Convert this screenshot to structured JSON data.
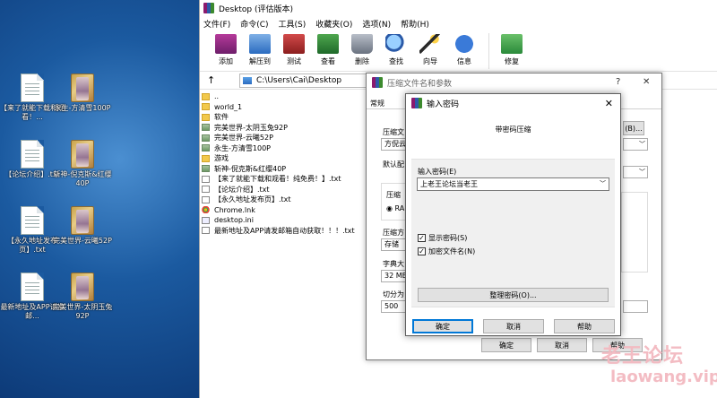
{
  "desktop": {
    "icons": [
      {
        "label": "【来了就能下载和观看！...",
        "type": "doc"
      },
      {
        "label": "永生-方清雪100P",
        "type": "folder"
      },
      {
        "label": "【论坛介绍】.txt",
        "type": "doc"
      },
      {
        "label": "斩神-倪克斯&红缨40P",
        "type": "folder"
      },
      {
        "label": "【永久地址发布页】.txt",
        "type": "doc"
      },
      {
        "label": "完美世界-云曦52P",
        "type": "folder"
      },
      {
        "label": "最新地址及APP请发邮...",
        "type": "doc"
      },
      {
        "label": "完美世界-太阴玉兔92P",
        "type": "folder"
      }
    ]
  },
  "window": {
    "title": "Desktop (评估版本)",
    "menu": [
      "文件(F)",
      "命令(C)",
      "工具(S)",
      "收藏夹(O)",
      "选项(N)",
      "帮助(H)"
    ],
    "toolbar": [
      {
        "label": "添加",
        "icon": "add-icon"
      },
      {
        "label": "解压到",
        "icon": "extract-icon"
      },
      {
        "label": "测试",
        "icon": "test-icon"
      },
      {
        "label": "查看",
        "icon": "view-icon"
      },
      {
        "label": "删除",
        "icon": "delete-icon"
      },
      {
        "label": "查找",
        "icon": "find-icon"
      },
      {
        "label": "向导",
        "icon": "wizard-icon"
      },
      {
        "label": "信息",
        "icon": "info-icon"
      },
      {
        "label": "修复",
        "icon": "repair-icon"
      }
    ],
    "address": "C:\\Users\\Cai\\Desktop",
    "files": [
      {
        "name": "..",
        "type": "folder"
      },
      {
        "name": "world_1",
        "type": "folder"
      },
      {
        "name": "软件",
        "type": "folder"
      },
      {
        "name": "完美世界-太阴玉兔92P",
        "type": "zip"
      },
      {
        "name": "完美世界-云曦52P",
        "type": "zip"
      },
      {
        "name": "永生-方清雪100P",
        "type": "zip"
      },
      {
        "name": "游戏",
        "type": "folder"
      },
      {
        "name": "斩神-倪克斯&红缨40P",
        "type": "zip"
      },
      {
        "name": "【来了就能下载和观看！纯免费！】.txt",
        "type": "txt"
      },
      {
        "name": "【论坛介绍】.txt",
        "type": "txt"
      },
      {
        "name": "【永久地址发布页】.txt",
        "type": "txt"
      },
      {
        "name": "Chrome.lnk",
        "type": "lnk"
      },
      {
        "name": "desktop.ini",
        "type": "ini"
      },
      {
        "name": "最新地址及APP请发邮箱自动获取！！！.txt",
        "type": "txt"
      }
    ]
  },
  "archive_dialog": {
    "title": "压缩文件名和参数",
    "help_glyph": "?",
    "close_glyph": "✕",
    "tab_general": "常规",
    "archive_name_label": "压缩文",
    "archive_name_value": "方倪云",
    "browse_label": "(B)...",
    "default_profile_label": "默认配",
    "format_group_label": "压缩",
    "format_value": "RA",
    "method_label": "压缩方",
    "method_value": "存储",
    "dict_label": "字典大",
    "dict_value": "32 MB",
    "split_label": "切分为",
    "split_value": "500",
    "ok_label": "确定",
    "cancel_label": "取消",
    "help_label": "帮助"
  },
  "password_dialog": {
    "title": "输入密码",
    "close_glyph": "✕",
    "heading": "带密码压缩",
    "password_label": "输入密码(E)",
    "password_value": "上老王论坛当老王",
    "show_password_label": "显示密码(S)",
    "show_password_checked": true,
    "encrypt_names_label": "加密文件名(N)",
    "encrypt_names_checked": true,
    "organize_label": "整理密码(O)...",
    "ok_label": "确定",
    "cancel_label": "取消",
    "help_label": "帮助"
  },
  "watermark": {
    "line1": "老王论坛",
    "line2": "laowang.vip"
  }
}
